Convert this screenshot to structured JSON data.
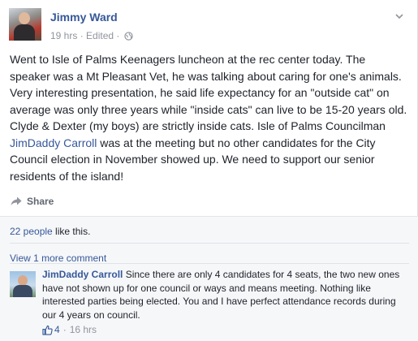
{
  "post": {
    "author": "Jimmy Ward",
    "time": "19 hrs",
    "edited": "Edited",
    "text_part1": "Went to Isle of Palms Keenagers luncheon at the rec center today. The speaker was a Mt Pleasant Vet, he was talking about caring for one's animals. Very interesting presentation, he said life expectancy for an \"outside cat\" on average was only three years while \"inside cats\" can live to be 15-20 years old. Clyde & Dexter (my boys) are strictly inside cats. Isle of Palms Councilman ",
    "mention": "JimDaddy Carroll",
    "text_part2": " was at the meeting but no other candidates for the City Council election in November showed up. We need to support our senior residents of the island!"
  },
  "actions": {
    "share_label": "Share"
  },
  "reactions": {
    "people": "22 people",
    "suffix": " like this."
  },
  "comments": {
    "view_more": "View 1 more comment",
    "items": [
      {
        "name": "JimDaddy Carroll",
        "text": " Since there are only 4 candidates for 4 seats, the two new ones have not shown up for one council or ways and means meeting. Nothing like interested parties being elected. You and I have perfect attendance records during our 4 years on council.",
        "likes": "4",
        "time": "16 hrs"
      }
    ]
  },
  "icons": {
    "globe": "globe-icon",
    "chevron": "chevron-down-icon",
    "share": "share-arrow-icon",
    "like": "thumbs-up-icon"
  },
  "colors": {
    "link": "#365899",
    "meta": "#90949c",
    "text": "#1d2129",
    "comment_bg": "#f6f7f9"
  }
}
